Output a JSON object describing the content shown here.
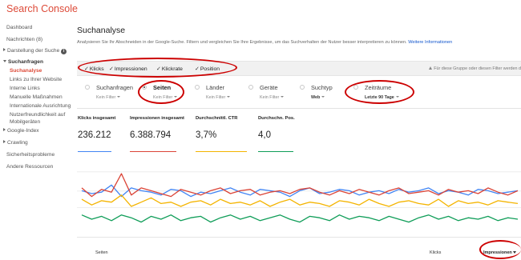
{
  "app": {
    "title": "Search Console"
  },
  "sidebar": {
    "items": [
      {
        "label": "Dashboard"
      },
      {
        "label": "Nachrichten (8)"
      },
      {
        "label": "Darstellung der Suche"
      },
      {
        "label": "Suchanfragen"
      },
      {
        "label": "Suchanalyse"
      },
      {
        "label": "Links zu Ihrer Website"
      },
      {
        "label": "Interne Links"
      },
      {
        "label": "Manuelle Maßnahmen"
      },
      {
        "label": "Internationale Ausrichtung"
      },
      {
        "label": "Nutzerfreundlichkeit auf"
      },
      {
        "label": "Mobilgeräten"
      },
      {
        "label": "Google-Index"
      },
      {
        "label": "Crawling"
      },
      {
        "label": "Sicherheitsprobleme"
      },
      {
        "label": "Andere Ressourcen"
      }
    ]
  },
  "page": {
    "title": "Suchanalyse",
    "description": "Analysieren Sie Ihr Abschneiden in der Google-Suche. Filtern und vergleichen Sie Ihre Ergebnisse, um das Suchverhalten der Nutzer besser interpretieren zu können.",
    "more_link": "Weitere Informationen"
  },
  "toolbar": {
    "checkboxes": [
      {
        "label": "Klicks",
        "checked": true
      },
      {
        "label": "Impressionen",
        "checked": true
      },
      {
        "label": "Klickrate",
        "checked": true
      },
      {
        "label": "Position",
        "checked": true
      }
    ],
    "filter_hint": "Für diese Gruppe oder diesen Filter werden d"
  },
  "dimensions": [
    {
      "label": "Suchanfragen",
      "filter": "Kein Filter",
      "selected": false
    },
    {
      "label": "Seiten",
      "filter": "Kein Filter",
      "selected": true
    },
    {
      "label": "Länder",
      "filter": "Kein Filter",
      "selected": false
    },
    {
      "label": "Geräte",
      "filter": "Kein Filter",
      "selected": false
    },
    {
      "label": "Suchtyp",
      "filter": "Web",
      "selected": false
    },
    {
      "label": "Zeiträume",
      "filter": "Letzte 90 Tage",
      "selected": false
    }
  ],
  "metrics": [
    {
      "label": "Klicks insgesamt",
      "value": "236.212",
      "color": "#4285f4"
    },
    {
      "label": "Impressionen insgesamt",
      "value": "6.388.794",
      "color": "#db4437"
    },
    {
      "label": "Durchschnittl. CTR",
      "value": "3,7%",
      "color": "#f4b400"
    },
    {
      "label": "Durchschn. Pos.",
      "value": "4,0",
      "color": "#0f9d58"
    }
  ],
  "table": {
    "columns": {
      "pages": "Seiten",
      "clicks": "Klicks",
      "impressions": "Impressionen"
    }
  },
  "chart_data": {
    "type": "line",
    "x_count": 45,
    "grid": true,
    "series": [
      {
        "name": "Klicks insgesamt",
        "color": "#4285f4",
        "values": [
          44,
          42,
          43,
          48,
          40,
          46,
          44,
          43,
          41,
          45,
          44,
          40,
          43,
          42,
          44,
          46,
          43,
          41,
          45,
          44,
          43,
          40,
          44,
          46,
          42,
          43,
          45,
          44,
          41,
          43,
          44,
          42,
          45,
          43,
          44,
          46,
          42,
          44,
          43,
          41,
          45,
          44,
          42,
          43,
          44
        ]
      },
      {
        "name": "Impressionen insgesamt",
        "color": "#db4437",
        "values": [
          46,
          40,
          45,
          43,
          56,
          41,
          46,
          44,
          42,
          40,
          45,
          43,
          41,
          44,
          46,
          42,
          44,
          45,
          41,
          43,
          44,
          42,
          45,
          46,
          43,
          41,
          44,
          42,
          45,
          43,
          41,
          44,
          46,
          42,
          43,
          44,
          41,
          45,
          43,
          44,
          42,
          46,
          43,
          41,
          44
        ]
      },
      {
        "name": "Durchschnittl. CTR",
        "color": "#f4b400",
        "values": [
          38,
          34,
          37,
          36,
          41,
          33,
          36,
          39,
          35,
          36,
          33,
          36,
          37,
          34,
          38,
          35,
          36,
          34,
          37,
          33,
          36,
          38,
          34,
          36,
          35,
          33,
          37,
          36,
          34,
          38,
          35,
          33,
          36,
          37,
          35,
          34,
          38,
          33,
          37,
          35,
          36,
          34,
          37,
          36,
          35
        ]
      },
      {
        "name": "Durchschn. Pos.",
        "color": "#0f9d58",
        "values": [
          27,
          24,
          26,
          23,
          27,
          25,
          22,
          26,
          24,
          27,
          23,
          25,
          26,
          22,
          25,
          27,
          24,
          26,
          23,
          25,
          27,
          24,
          22,
          26,
          25,
          23,
          27,
          24,
          26,
          25,
          23,
          26,
          24,
          22,
          25,
          27,
          24,
          26,
          23,
          25,
          24,
          26,
          23,
          25,
          24
        ]
      }
    ]
  }
}
